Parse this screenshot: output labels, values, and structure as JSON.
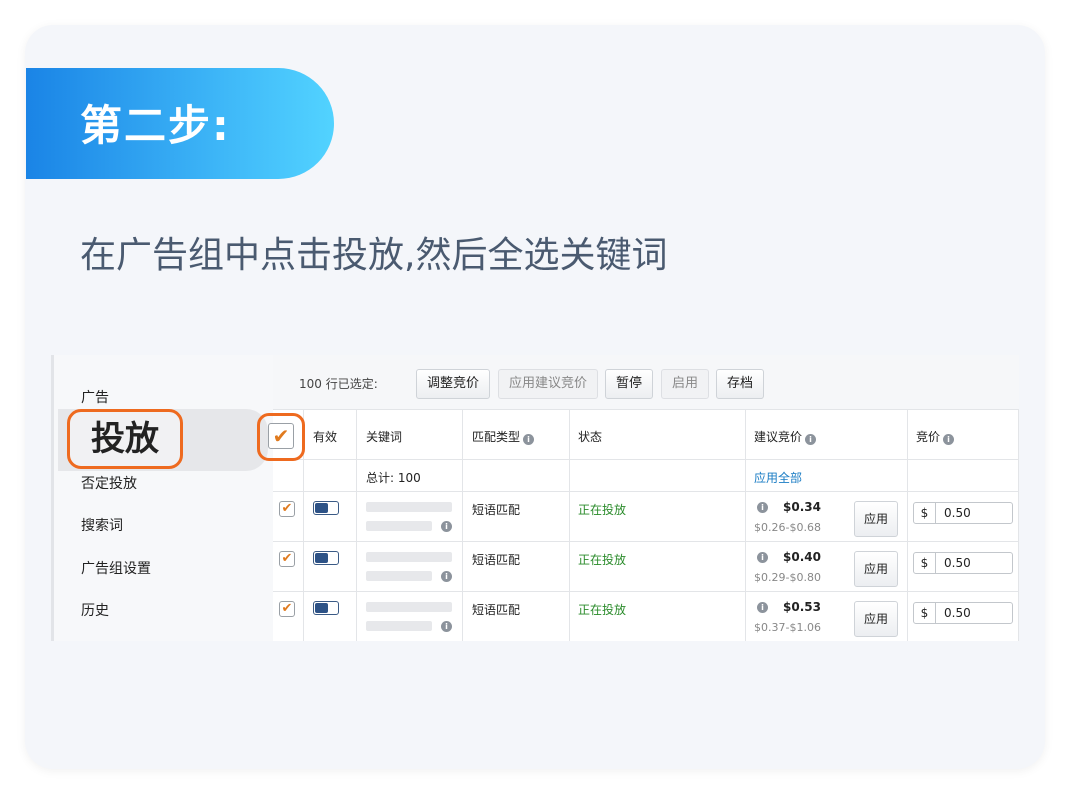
{
  "step_title": "第二步:",
  "subtitle": "在广告组中点击投放,然后全选关键词",
  "sidebar": {
    "items": [
      {
        "label": "广告"
      },
      {
        "label": "投放"
      },
      {
        "label": "否定投放"
      },
      {
        "label": "搜索词"
      },
      {
        "label": "广告组设置"
      },
      {
        "label": "历史"
      }
    ],
    "active": "投放"
  },
  "toolbar": {
    "selected_count": "100 行已选定:",
    "buttons": [
      {
        "label": "调整竞价",
        "enabled": true
      },
      {
        "label": "应用建议竞价",
        "enabled": false
      },
      {
        "label": "暂停",
        "enabled": true
      },
      {
        "label": "启用",
        "enabled": false
      },
      {
        "label": "存档",
        "enabled": true
      }
    ]
  },
  "table": {
    "headers": {
      "active": "有效",
      "keyword": "关键词",
      "match_type": "匹配类型",
      "status": "状态",
      "suggested_bid": "建议竞价",
      "bid": "竞价"
    },
    "summary": {
      "total": "总计: 100",
      "apply_all": "应用全部"
    },
    "rows": [
      {
        "checked": true,
        "enabled": true,
        "match_type": "短语匹配",
        "status": "正在投放",
        "suggested_bid": "$0.34",
        "suggested_range": "$0.26-$0.68",
        "apply_label": "应用",
        "currency": "$",
        "bid": "0.50"
      },
      {
        "checked": true,
        "enabled": true,
        "match_type": "短语匹配",
        "status": "正在投放",
        "suggested_bid": "$0.40",
        "suggested_range": "$0.29-$0.80",
        "apply_label": "应用",
        "currency": "$",
        "bid": "0.50"
      },
      {
        "checked": true,
        "enabled": true,
        "match_type": "短语匹配",
        "status": "正在投放",
        "suggested_bid": "$0.53",
        "suggested_range": "$0.37-$1.06",
        "apply_label": "应用",
        "currency": "$",
        "bid": "0.50"
      }
    ]
  },
  "colors": {
    "accent_orange": "#ee6a1f",
    "banner_start": "#1a84e6",
    "banner_end": "#52d3ff",
    "status_green": "#2a8b2a",
    "link_blue": "#1a7cc4"
  },
  "icons": {
    "check": "check-icon",
    "info": "info-icon"
  }
}
